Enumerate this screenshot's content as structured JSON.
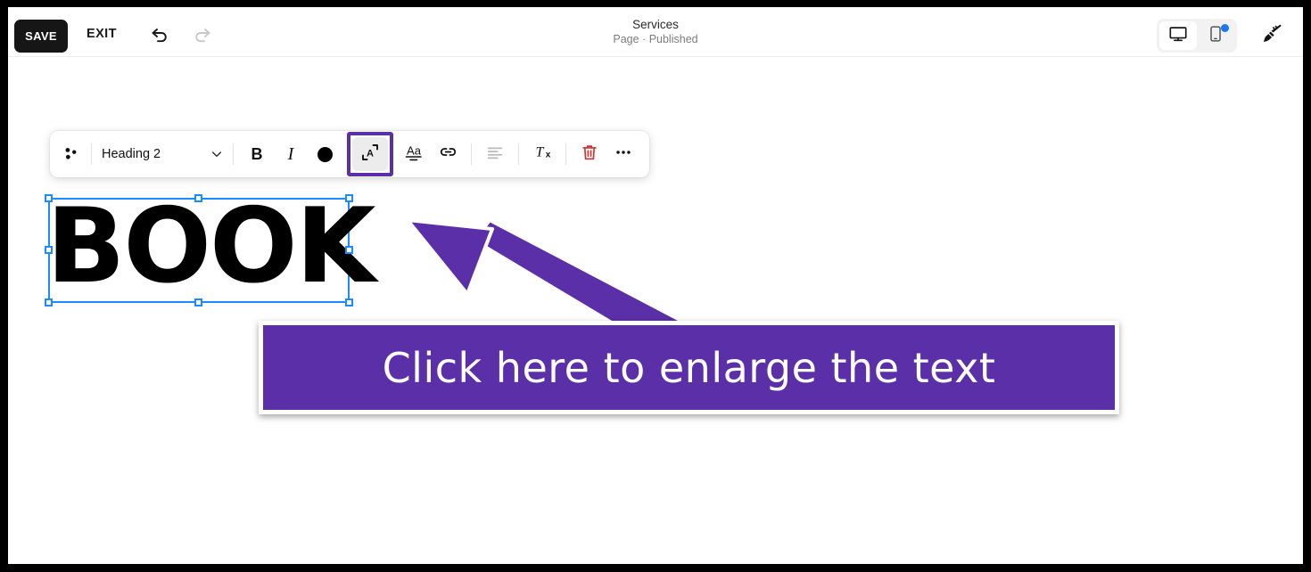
{
  "topbar": {
    "save_label": "SAVE",
    "exit_label": "EXIT",
    "undo_icon": "undo-icon",
    "redo_icon": "redo-icon",
    "page_title": "Services",
    "page_subtitle": "Page · Published",
    "desktop_icon": "desktop-monitor-icon",
    "mobile_icon": "mobile-phone-icon",
    "mobile_badge": "notification-dot",
    "theme_icon": "paintbrush-icon"
  },
  "toolbar": {
    "drag_handle_icon": "drag-dots-icon",
    "style_value": "Heading 2",
    "style_caret_icon": "chevron-down-icon",
    "bold_label": "B",
    "italic_label": "I",
    "color_swatch_icon": "text-color-circle-icon",
    "color_swatch_value": "#000000",
    "fontsize_icon": "enlarge-text-icon",
    "fontsize_highlight_color": "#5B2FA8",
    "text_styles_label": "Aa",
    "link_icon": "link-chain-icon",
    "align_icon": "align-left-icon",
    "clear_format_label": "Tx",
    "delete_icon": "trash-can-icon",
    "delete_color": "#D32F2F",
    "more_icon": "more-horizontal-icon"
  },
  "canvas": {
    "selected_text": "BOOK",
    "selection_color": "#1A8CFF"
  },
  "annotation": {
    "banner_text": "Click here to enlarge the text",
    "accent_color": "#5B2FA8",
    "arrow_icon": "pointer-arrow-icon"
  }
}
